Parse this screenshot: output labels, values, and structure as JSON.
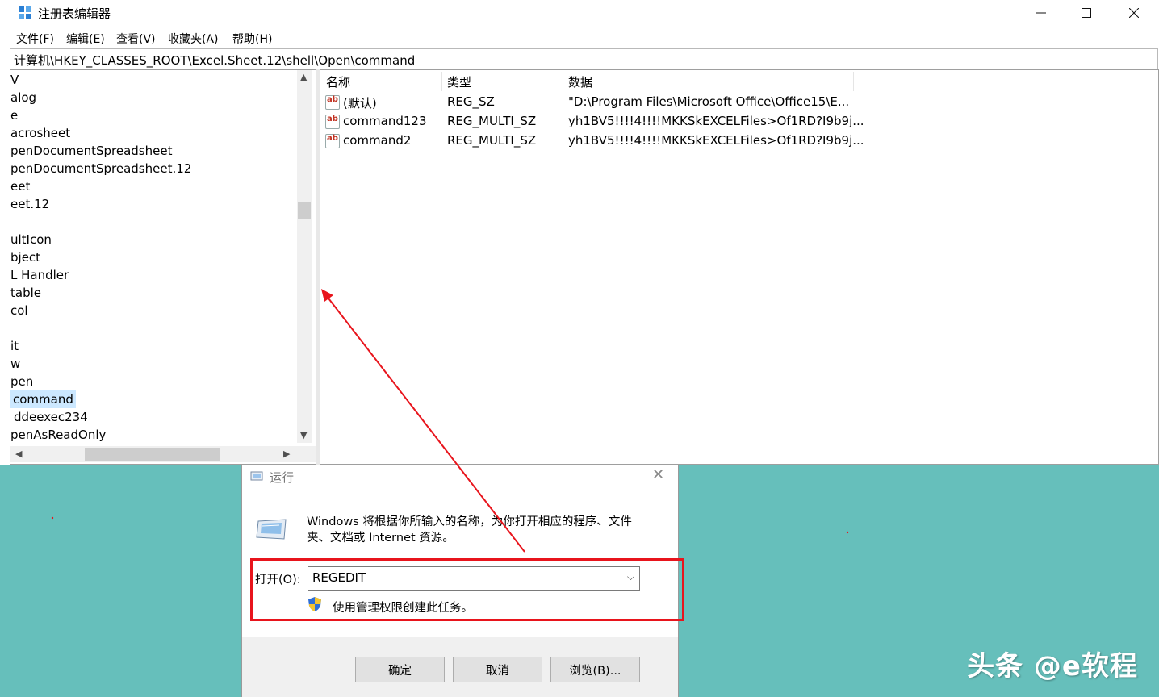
{
  "regedit": {
    "title": "注册表编辑器",
    "menu": [
      "文件(F)",
      "编辑(E)",
      "查看(V)",
      "收藏夹(A)",
      "帮助(H)"
    ],
    "address": "计算机\\HKEY_CLASSES_ROOT\\Excel.Sheet.12\\shell\\Open\\command",
    "tree_items": [
      "V",
      "alog",
      "e",
      "acrosheet",
      "penDocumentSpreadsheet",
      "penDocumentSpreadsheet.12",
      "eet",
      "eet.12",
      "",
      "ultIcon",
      "bject",
      "L Handler",
      "table",
      "col",
      "",
      "it",
      "w",
      "pen",
      "command",
      "ddeexec234",
      "penAsReadOnly"
    ],
    "selected_tree_item": "command",
    "columns": {
      "name": "名称",
      "type": "类型",
      "data": "数据"
    },
    "values": [
      {
        "name": "(默认)",
        "type": "REG_SZ",
        "data": "\"D:\\Program Files\\Microsoft Office\\Office15\\E..."
      },
      {
        "name": "command123",
        "type": "REG_MULTI_SZ",
        "data": "yh1BV5!!!!4!!!!MKKSkEXCELFiles>Of1RD?I9b9j..."
      },
      {
        "name": "command2",
        "type": "REG_MULTI_SZ",
        "data": "yh1BV5!!!!4!!!!MKKSkEXCELFiles>Of1RD?I9b9j..."
      }
    ]
  },
  "run": {
    "title": "运行",
    "description": "Windows 将根据你所输入的名称，为你打开相应的程序、文件夹、文档或 Internet 资源。",
    "open_label": "打开(O):",
    "open_value": "REGEDIT",
    "admin_note": "使用管理权限创建此任务。",
    "buttons": {
      "ok": "确定",
      "cancel": "取消",
      "browse": "浏览(B)..."
    }
  },
  "watermark": "头条 @e软程",
  "colors": {
    "highlight": "#e8141c",
    "arrow": "#e8141c",
    "desktop": "#66bfbb",
    "selection": "#cce8ff"
  }
}
